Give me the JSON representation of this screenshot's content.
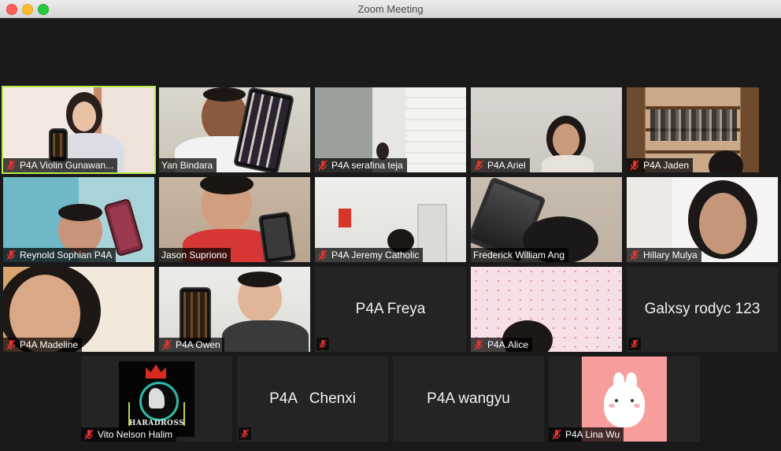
{
  "window": {
    "title": "Zoom Meeting"
  },
  "colors": {
    "active_speaker_border": "#b6e94d",
    "muted_icon": "#e8322e"
  },
  "participants": [
    {
      "name": "P4A Violin Gunawan...",
      "muted": true,
      "video": true,
      "active": true
    },
    {
      "name": "Yan Bindara",
      "muted": false,
      "video": true
    },
    {
      "name": "P4A serafina teja",
      "muted": true,
      "video": true
    },
    {
      "name": "P4A Ariel",
      "muted": true,
      "video": true
    },
    {
      "name": "P4A Jaden",
      "muted": true,
      "video": true
    },
    {
      "name": "Reynold Sophian P4A",
      "muted": true,
      "video": true
    },
    {
      "name": "Jason Supriono",
      "muted": false,
      "video": true
    },
    {
      "name": "P4A Jeremy Catholic",
      "muted": true,
      "video": true
    },
    {
      "name": "Frederick William Ang",
      "muted": false,
      "video": true
    },
    {
      "name": "Hillary Mulya",
      "muted": true,
      "video": true
    },
    {
      "name": "P4A Madeline",
      "muted": true,
      "video": true
    },
    {
      "name": "P4A Owen",
      "muted": true,
      "video": true
    },
    {
      "name": "P4A Freya",
      "muted": true,
      "video": false
    },
    {
      "name": "P4A.Alice",
      "muted": true,
      "video": true
    },
    {
      "name": "Galxsy rodyc 123",
      "muted": true,
      "video": false
    },
    {
      "name": "Vito Nelson Halim",
      "muted": true,
      "video": false,
      "avatar": "HARADROSS"
    },
    {
      "name": "P4A   Chenxi",
      "muted": true,
      "video": false
    },
    {
      "name": "P4A wangyu",
      "muted": false,
      "video": false
    },
    {
      "name": "P4A Lina Wu",
      "muted": true,
      "video": false,
      "avatar": "bunny"
    }
  ]
}
